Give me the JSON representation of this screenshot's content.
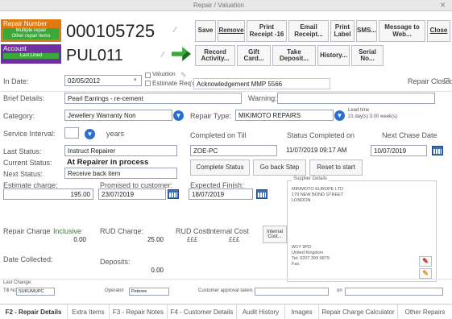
{
  "window": {
    "title": "Repair / Valuation",
    "close_glyph": "×"
  },
  "header": {
    "repair_number_label": "Repair Number",
    "repair_number_sub1": "Multiple repair",
    "repair_number_sub2": "Other repair items",
    "repair_number": "000105725",
    "account_label": "Account",
    "account_sub": "Last Lined",
    "account_code": "PUL011"
  },
  "toolbar": {
    "save": "Save",
    "remove": "Remove",
    "print_receipt": "Print Receipt ‑16",
    "email_receipt": "Email Receipt...",
    "print_label": "Print Label",
    "sms": "SMS...",
    "message_web": "Message to Web...",
    "close": "Close",
    "record_activity": "Record Activity...",
    "gift_card": "Gift Card...",
    "take_deposit": "Take Deposit...",
    "history": "History...",
    "serial_no": "Serial No..."
  },
  "form": {
    "in_date_label": "In Date:",
    "in_date": "02/05/2012",
    "valuation_label": "Valuation",
    "estimate_req_label": "Estimate Req'd",
    "acknowledgement": "Acknowledgement MMP 5566",
    "repair_closed_label": "Repair Closed",
    "brief_details_label": "Brief Details:",
    "brief_details": "Pearl Earrings - re-cement",
    "warning_label": "Warning:",
    "warning": "",
    "category_label": "Category:",
    "category": "Jewellery Warranty Non",
    "repair_type_label": "Repair Type:",
    "repair_type": "MIKIMOTO REPAIRS",
    "lead_time_label": "Lead time",
    "lead_time_value": "21 day(s) 3.00 week(s)",
    "service_interval_label": "Service Interval:",
    "service_interval": "",
    "years_label": "years",
    "completed_on_till_label": "Completed on Till",
    "status_completed_on_label": "Status Completed on",
    "next_chase_label": "Next Chase Date",
    "last_status_label": "Last Status:",
    "last_status": "Instruct Repairer",
    "completed_till": "ZOE-PC",
    "status_completed_on": "11/07/2019 09:17 AM",
    "next_chase": "10/07/2019",
    "current_status_label": "Current Status:",
    "current_status": "At Repairer in process",
    "next_status_label": "Next Status:",
    "next_status": "Receive back item",
    "complete_status": "Complete Status",
    "go_back_step": "Go back Step",
    "reset_to_start": "Reset to start",
    "estimate_charge_label": "Estimate charge:",
    "estimate_charge": "195.00",
    "promised_label": "Promised to customer:",
    "promised": "23/07/2019",
    "expected_finish_label": "Expected Finish:",
    "expected_finish": "18/07/2019",
    "repair_charge_label": "Repair Charge",
    "inclusive_label": "Inclusive",
    "repair_charge": "0.00",
    "rud_charge_label": "RUD Charge:",
    "rud_charge": "25.00",
    "rud_cost_label": "RUD Cost:",
    "rud_cost": "£££",
    "internal_cost_label": "Internal Cost",
    "internal_cost": "£££",
    "internal_costs_btn": "Internal Cost...",
    "date_collected_label": "Date Collected:",
    "date_collected": "",
    "deposits_label": "Deposits:",
    "deposits": "0.00",
    "last_change_label": "Last Change:",
    "till_label": "Till No",
    "till": "SUKUMUPC",
    "operator_label": "Operator",
    "operator": "Peteree",
    "customer_approval_label": "Customer approval taken:",
    "customer_approval": "",
    "on_label": "on",
    "on_value": ""
  },
  "supplier": {
    "title": "Supplier Details",
    "lines": [
      "MIKIMOTO EUROPE LTD",
      "179 NEW BOND STREET",
      "LONDON",
      "",
      "",
      "W1Y 9PD",
      "United Kingdom",
      "Tel: 0207 399 9879",
      "Fax:"
    ]
  },
  "tabs": [
    "F2 - Repair Details",
    "Extra Items",
    "F3 - Repair Notes",
    "F4 - Customer Details",
    "Audit History",
    "Images",
    "Repair Charge Calculator",
    "Other Repairs"
  ],
  "colors": {
    "accent_orange": "#e07a10",
    "accent_purple": "#7030a0",
    "accent_green": "#3aa83a",
    "stop_red": "#d02020",
    "info_blue": "#2a6fd0"
  }
}
